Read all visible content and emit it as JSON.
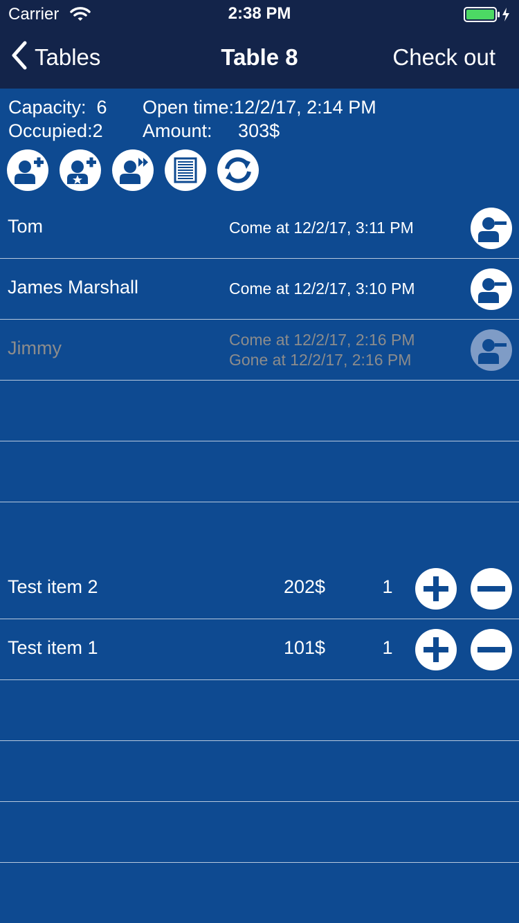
{
  "status": {
    "carrier": "Carrier",
    "time": "2:38 PM"
  },
  "nav": {
    "back_label": "Tables",
    "title": "Table 8",
    "checkout_label": "Check out"
  },
  "info": {
    "capacity": "Capacity:  6",
    "occupied": "Occupied:2",
    "open_time": "Open time:12/2/17, 2:14 PM",
    "amount": "Amount:     303$"
  },
  "actions": [
    "add-guest-icon",
    "add-vip-guest-icon",
    "move-guest-icon",
    "menu-list-icon",
    "refresh-icon"
  ],
  "guests": [
    {
      "name": "Tom",
      "come": "Come at 12/2/17, 3:11 PM",
      "gone": ""
    },
    {
      "name": "James Marshall",
      "come": "Come at 12/2/17, 3:10 PM",
      "gone": ""
    },
    {
      "name": "Jimmy",
      "come": "Come at 12/2/17, 2:16 PM",
      "gone": "Gone at 12/2/17, 2:16 PM"
    }
  ],
  "items": [
    {
      "name": "Test item 2",
      "price": "202$",
      "qty": "1"
    },
    {
      "name": "Test item 1",
      "price": "101$",
      "qty": "1"
    }
  ],
  "colors": {
    "background": "#0e4a91",
    "nav": "#13244a",
    "battery": "#4cd964"
  }
}
